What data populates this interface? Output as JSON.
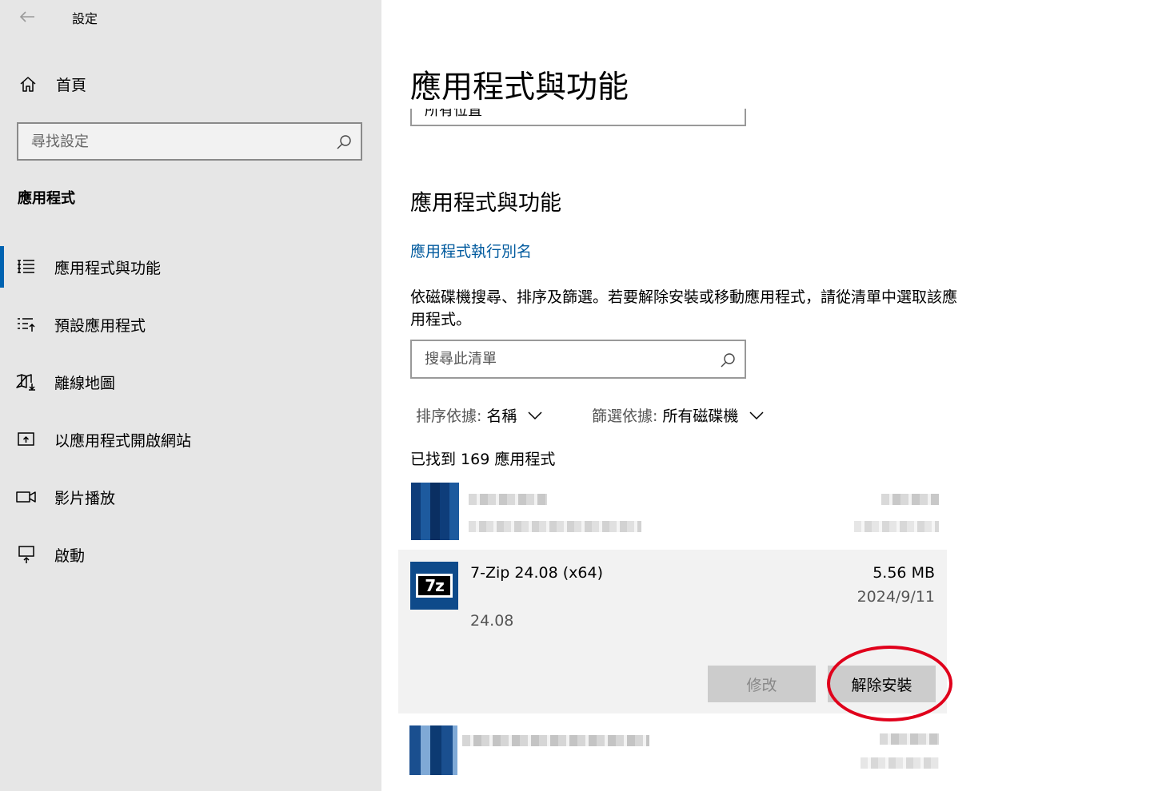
{
  "window": {
    "title": "設定"
  },
  "sidebar": {
    "home_label": "首頁",
    "search_placeholder": "尋找設定",
    "section_heading": "應用程式",
    "items": [
      {
        "label": "應用程式與功能",
        "icon": "apps-list-icon",
        "active": true
      },
      {
        "label": "預設應用程式",
        "icon": "default-apps-icon",
        "active": false
      },
      {
        "label": "離線地圖",
        "icon": "offline-map-icon",
        "active": false
      },
      {
        "label": "以應用程式開啟網站",
        "icon": "open-website-icon",
        "active": false
      },
      {
        "label": "影片播放",
        "icon": "video-camera-icon",
        "active": false
      },
      {
        "label": "啟動",
        "icon": "startup-icon",
        "active": false
      }
    ]
  },
  "main": {
    "page_title": "應用程式與功能",
    "prev_dropdown_text": "所有位置",
    "section_title": "應用程式與功能",
    "alias_link": "應用程式執行別名",
    "description": "依磁碟機搜尋、排序及篩選。若要解除安裝或移動應用程式，請從清單中選取該應用程式。",
    "list_search_placeholder": "搜尋此清單",
    "sort": {
      "label": "排序依據:",
      "value": "名稱"
    },
    "filter": {
      "label": "篩選依據:",
      "value": "所有磁碟機"
    },
    "count_text": "已找到 169 應用程式",
    "selected_app": {
      "name": "7-Zip 24.08 (x64)",
      "size": "5.56 MB",
      "date": "2024/9/11",
      "version": "24.08",
      "icon_text": "7z",
      "modify_label": "修改",
      "uninstall_label": "解除安裝"
    }
  },
  "colors": {
    "sidebar_bg": "#e6e6e6",
    "accent": "#0063b1",
    "link": "#005a9e",
    "selected_row_bg": "#f2f2f2",
    "button_bg": "#cccccc",
    "highlight_ring": "#e0001b"
  }
}
